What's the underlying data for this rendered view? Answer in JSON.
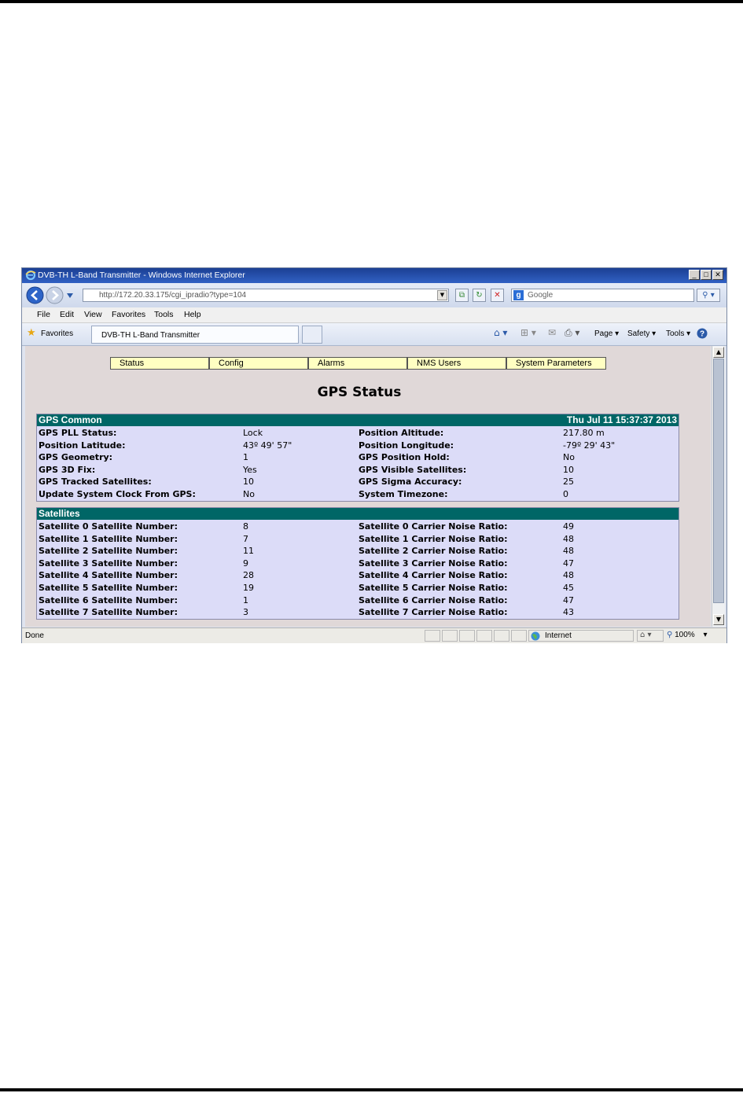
{
  "window": {
    "title": "DVB-TH L-Band Transmitter - Windows Internet Explorer",
    "minimize": "_",
    "maximize": "□",
    "close": "✕"
  },
  "address": {
    "url": "http://172.20.33.175/cgi_ipradio?type=104",
    "search_placeholder": "Google"
  },
  "menu": [
    "File",
    "Edit",
    "View",
    "Favorites",
    "Tools",
    "Help"
  ],
  "favorites": {
    "label": "Favorites",
    "tab_title": "DVB-TH L-Band Transmitter"
  },
  "commands": {
    "page": "Page ▾",
    "safety": "Safety ▾",
    "tools": "Tools ▾"
  },
  "nav": [
    "Status",
    "Config",
    "Alarms",
    "NMS Users",
    "System Parameters"
  ],
  "heading": "GPS Status",
  "gps_common": {
    "title": "GPS Common",
    "datetime": "Thu Jul 11 15:37:37 2013",
    "rows": [
      {
        "k1": "GPS PLL Status:",
        "v1": "Lock",
        "k2": "Position Altitude:",
        "v2": "217.80 m"
      },
      {
        "k1": "Position Latitude:",
        "v1": "43º 49' 57\"",
        "k2": "Position Longitude:",
        "v2": "-79º 29' 43\""
      },
      {
        "k1": "GPS Geometry:",
        "v1": "1",
        "k2": "GPS Position Hold:",
        "v2": "No"
      },
      {
        "k1": "GPS 3D Fix:",
        "v1": "Yes",
        "k2": "GPS Visible Satellites:",
        "v2": "10"
      },
      {
        "k1": "GPS Tracked Satellites:",
        "v1": "10",
        "k2": "GPS Sigma Accuracy:",
        "v2": "25"
      },
      {
        "k1": "Update System Clock From GPS:",
        "v1": "No",
        "k2": "System Timezone:",
        "v2": "0"
      }
    ]
  },
  "satellites": {
    "title": "Satellites",
    "rows": [
      {
        "k1": "Satellite 0 Satellite Number:",
        "v1": "8",
        "k2": "Satellite 0 Carrier Noise Ratio:",
        "v2": "49"
      },
      {
        "k1": "Satellite 1 Satellite Number:",
        "v1": "7",
        "k2": "Satellite 1 Carrier Noise Ratio:",
        "v2": "48"
      },
      {
        "k1": "Satellite 2 Satellite Number:",
        "v1": "11",
        "k2": "Satellite 2 Carrier Noise Ratio:",
        "v2": "48"
      },
      {
        "k1": "Satellite 3 Satellite Number:",
        "v1": "9",
        "k2": "Satellite 3 Carrier Noise Ratio:",
        "v2": "47"
      },
      {
        "k1": "Satellite 4 Satellite Number:",
        "v1": "28",
        "k2": "Satellite 4 Carrier Noise Ratio:",
        "v2": "48"
      },
      {
        "k1": "Satellite 5 Satellite Number:",
        "v1": "19",
        "k2": "Satellite 5 Carrier Noise Ratio:",
        "v2": "45"
      },
      {
        "k1": "Satellite 6 Satellite Number:",
        "v1": "1",
        "k2": "Satellite 6 Carrier Noise Ratio:",
        "v2": "47"
      },
      {
        "k1": "Satellite 7 Satellite Number:",
        "v1": "3",
        "k2": "Satellite 7 Carrier Noise Ratio:",
        "v2": "43"
      }
    ]
  },
  "status": {
    "text": "Done",
    "zone": "Internet",
    "zoom": "100%"
  },
  "icons": [
    "ie-logo-icon",
    "back-icon",
    "forward-icon",
    "compat-view-icon",
    "refresh-icon",
    "stop-icon",
    "search-icon",
    "star-icon",
    "home-icon",
    "feeds-icon",
    "mail-icon",
    "print-icon",
    "help-icon",
    "globe-icon"
  ]
}
